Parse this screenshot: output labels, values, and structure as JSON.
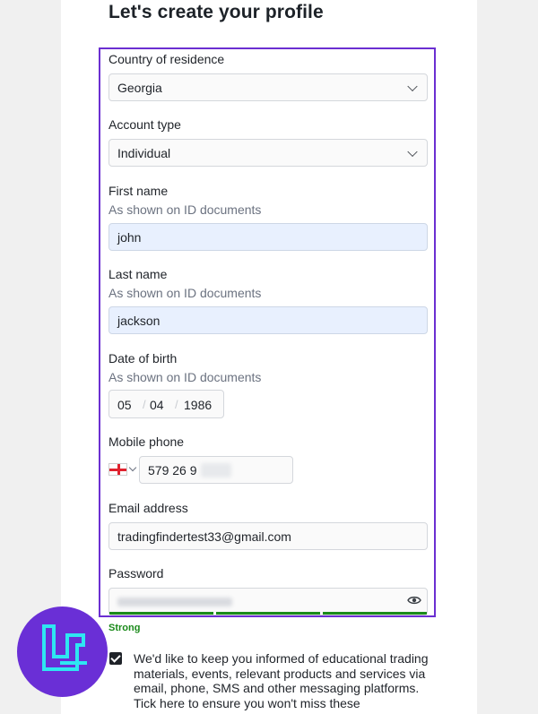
{
  "page": {
    "title": "Let's create your profile"
  },
  "form": {
    "country": {
      "label": "Country of residence",
      "value": "Georgia"
    },
    "account_type": {
      "label": "Account type",
      "value": "Individual"
    },
    "first_name": {
      "label": "First name",
      "hint": "As shown on ID documents",
      "value": "john"
    },
    "last_name": {
      "label": "Last name",
      "hint": "As shown on ID documents",
      "value": "jackson"
    },
    "dob": {
      "label": "Date of birth",
      "hint": "As shown on ID documents",
      "day": "05",
      "month": "04",
      "year": "1986",
      "separator": "/"
    },
    "phone": {
      "label": "Mobile phone",
      "value": "579 26 9"
    },
    "email": {
      "label": "Email address",
      "value": "tradingfindertest33@gmail.com"
    },
    "password": {
      "label": "Password",
      "strength": "Strong",
      "strength_level": 1.0
    }
  },
  "consent": {
    "checked": true,
    "text": "We'd like to keep you informed of educational trading materials, events, relevant products and services via email, phone, SMS and other messaging platforms. Tick here to ensure you won't miss these"
  },
  "colors": {
    "highlight": "#6b2fd1",
    "strength": "#1a8a1a",
    "autofill": "#e8f0fe",
    "logo_bg": "#6a2fd6",
    "logo_fg": "#2ee6f2"
  },
  "icons": {
    "logo": "tradingfinder-logo",
    "eye": "eye-icon",
    "flag": "georgia-flag-icon"
  }
}
